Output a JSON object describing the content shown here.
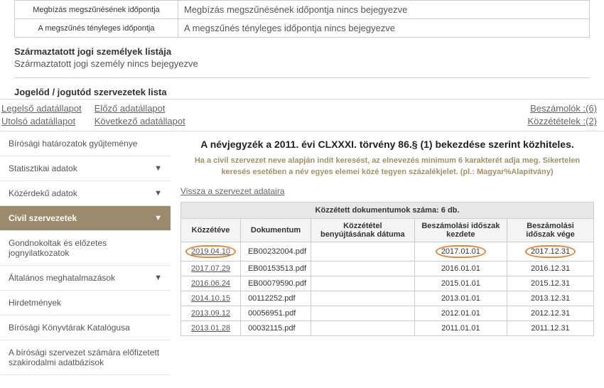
{
  "top_rows": [
    {
      "label": "Megbízás megszűnésének időpontja",
      "value": "Megbízás megszűnésének időpontja nincs bejegyezve"
    },
    {
      "label": "A megszűnés tényleges időpontja",
      "value": "A megszűnés tényleges időpontja nincs bejegyezve"
    }
  ],
  "section1": {
    "heading": "Származtatott jogi személyek listája",
    "sub": "Származtatott jogi személy nincs bejegyezve"
  },
  "section2": {
    "heading": "Jogelőd / jogutód szervezetek lista"
  },
  "nav": {
    "first": "Legelső adatállapot",
    "last": "Utolsó adatállapot",
    "prev": "Előző adatállapot",
    "next": "Következő adatállapot",
    "reports": "Beszámolók :(6)",
    "publications": "Közzétételek :(2)"
  },
  "sidebar": [
    {
      "label": "Bírósági határozatok gyűjteménye",
      "arrow": false
    },
    {
      "label": "Statisztikai adatok",
      "arrow": true
    },
    {
      "label": "Közérdekű adatok",
      "arrow": true
    },
    {
      "label": "Civil szervezetek",
      "arrow": true,
      "active": true
    },
    {
      "label": "Gondnokoltak és előzetes jognyilatkozatok",
      "arrow": false
    },
    {
      "label": "Általános meghatalmazások",
      "arrow": true
    },
    {
      "label": "Hirdetmények",
      "arrow": false
    },
    {
      "label": "Bírósági Könyvtárak Katalógusa",
      "arrow": false
    },
    {
      "label": "A bírósági szervezet számára előfizetett szakirodalmi adatbázisok",
      "arrow": false
    }
  ],
  "main": {
    "title": "A névjegyzék a 2011. évi CLXXXI. törvény 86.§ (1) bekezdése szerint közhiteles.",
    "note": "Ha a civil szervezet neve alapján indít keresést, az elnevezés minimum 6 karakterét adja meg. Sikertelen keresés esetében a név egyes elemei közé tegyen százalékjelet. (pl.: Magyar%Alapítvány)",
    "back": "Vissza a szervezet adataira",
    "table": {
      "caption": "Közzétett dokumentumok száma: 6 db.",
      "headers": [
        "Közzétéve",
        "Dokumentum",
        "Közzététel benyújtásának dátuma",
        "Beszámolási időszak kezdete",
        "Beszámolási időszak vége"
      ],
      "rows": [
        {
          "date": "2019.04.10",
          "doc": "EB00232004.pdf",
          "sub": "",
          "start": "2017.01.01",
          "end": "2017.12.31",
          "circled": true
        },
        {
          "date": "2017.07.29",
          "doc": "EB00153513.pdf",
          "sub": "",
          "start": "2016.01.01",
          "end": "2016.12.31"
        },
        {
          "date": "2016.06.24",
          "doc": "EB00079590.pdf",
          "sub": "",
          "start": "2015.01.01",
          "end": "2015.12.31"
        },
        {
          "date": "2014.10.15",
          "doc": "00112252.pdf",
          "sub": "",
          "start": "2013.01.01",
          "end": "2013.12.31"
        },
        {
          "date": "2013.09.12",
          "doc": "00056951.pdf",
          "sub": "",
          "start": "2012.01.01",
          "end": "2012.12.31"
        },
        {
          "date": "2013.01.28",
          "doc": "00032115.pdf",
          "sub": "",
          "start": "2011.01.01",
          "end": "2011.12.31"
        }
      ]
    }
  }
}
